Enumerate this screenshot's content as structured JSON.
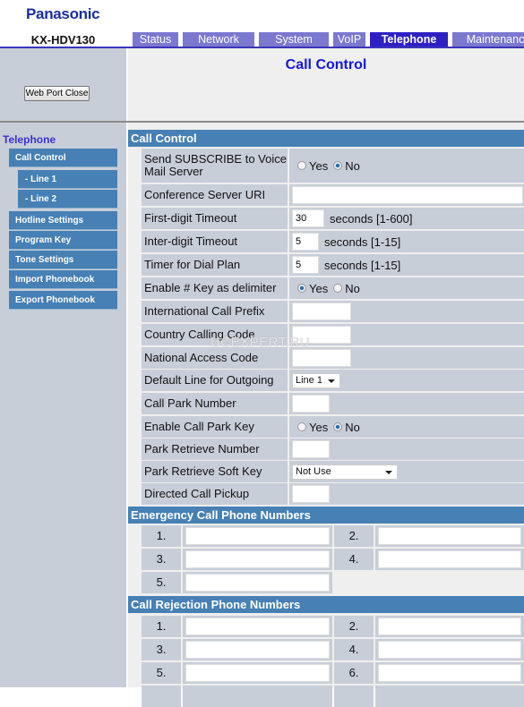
{
  "brand": "Panasonic",
  "model": "KX-HDV130",
  "tabs": [
    {
      "label": "Status"
    },
    {
      "label": "Network"
    },
    {
      "label": "System"
    },
    {
      "label": "VoIP"
    },
    {
      "label": "Telephone",
      "active": true
    },
    {
      "label": "Maintenance"
    }
  ],
  "page_title": "Call Control",
  "web_port_close": "Web Port Close",
  "sidebar": {
    "heading": "Telephone",
    "items": [
      {
        "label": "Call Control"
      },
      {
        "label": "- Line 1"
      },
      {
        "label": "- Line 2"
      },
      {
        "label": "Hotline Settings"
      },
      {
        "label": "Program Key"
      },
      {
        "label": "Tone Settings"
      },
      {
        "label": "Import Phonebook"
      },
      {
        "label": "Export Phonebook"
      }
    ]
  },
  "call_control": {
    "title": "Call Control",
    "yes": "Yes",
    "no": "No",
    "rows": [
      {
        "label": "Send SUBSCRIBE to Voice Mail Server",
        "type": "radio",
        "value": "No"
      },
      {
        "label": "Conference Server URI",
        "type": "text",
        "value": ""
      },
      {
        "label": "First-digit Timeout",
        "type": "text",
        "value": "30",
        "unit": "seconds [1-600]"
      },
      {
        "label": "Inter-digit Timeout",
        "type": "text",
        "value": "5",
        "unit": "seconds [1-15]"
      },
      {
        "label": "Timer for Dial Plan",
        "type": "text",
        "value": "5",
        "unit": "seconds [1-15]"
      },
      {
        "label": "Enable # Key as delimiter",
        "type": "radio",
        "value": "Yes"
      },
      {
        "label": "International Call Prefix",
        "type": "text",
        "value": ""
      },
      {
        "label": "Country Calling Code",
        "type": "text",
        "value": ""
      },
      {
        "label": "National Access Code",
        "type": "text",
        "value": ""
      },
      {
        "label": "Default Line for Outgoing",
        "type": "select",
        "value": "Line 1"
      },
      {
        "label": "Call Park Number",
        "type": "text",
        "value": ""
      },
      {
        "label": "Enable Call Park Key",
        "type": "radio",
        "value": "No"
      },
      {
        "label": "Park Retrieve Number",
        "type": "text",
        "value": ""
      },
      {
        "label": "Park Retrieve Soft Key",
        "type": "select",
        "value": "Not Use"
      },
      {
        "label": "Directed Call Pickup",
        "type": "text",
        "value": ""
      }
    ]
  },
  "emergency": {
    "title": "Emergency Call Phone Numbers",
    "numbers": [
      "1.",
      "2.",
      "3.",
      "4.",
      "5."
    ]
  },
  "rejection": {
    "title": "Call Rejection Phone Numbers",
    "numbers": [
      "1.",
      "2.",
      "3.",
      "4.",
      "5.",
      "6."
    ]
  },
  "watermark": "UCEXPERT.RU"
}
